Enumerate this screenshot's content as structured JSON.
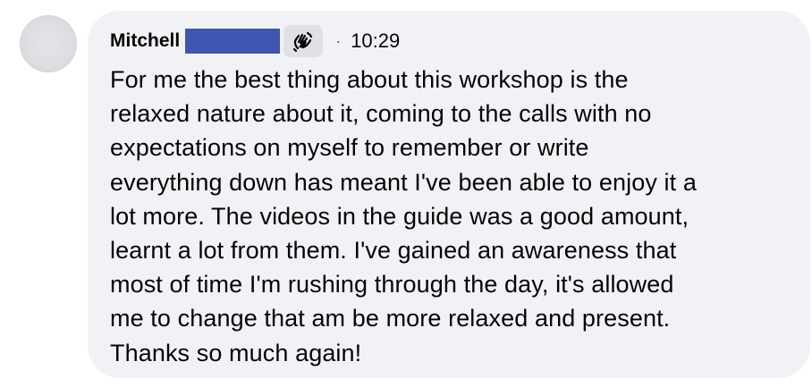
{
  "comment": {
    "author_name": "Mitchell",
    "badge_icon": "waving-hand-icon",
    "separator": "·",
    "time": "10:29",
    "lines": [
      "For me the best thing about this workshop is the",
      "relaxed nature about it, coming to the calls with no",
      "expectations on myself to remember or write",
      "everything down has meant I've been able to enjoy it a",
      "lot more. The videos in the guide was a good amount,",
      "learnt a lot from them. I've gained an awareness that",
      "most of time I'm rushing through the day, it's allowed",
      "me to change that am be more relaxed and present.",
      "Thanks so much again!"
    ]
  },
  "colors": {
    "bubble": "#f0f2f5",
    "redaction": "#4055b0",
    "text": "#050505",
    "muted": "#65676b"
  }
}
